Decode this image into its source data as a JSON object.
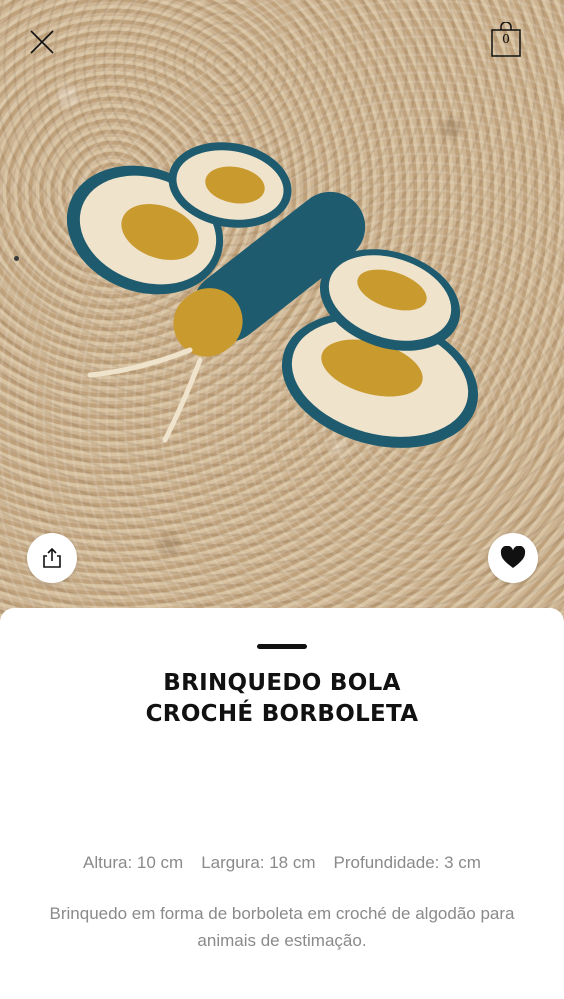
{
  "header": {
    "close_icon": "close-icon",
    "bag_icon": "shopping-bag-icon",
    "bag_count": "0"
  },
  "image": {
    "subject": "crochet-butterfly-toy",
    "colors": {
      "teal": "#1f5b6e",
      "mustard": "#c99a2e",
      "cream": "#efe3cc",
      "rug": "#c8ad88"
    }
  },
  "actions": {
    "share_icon": "share-icon",
    "favorite_icon": "heart-icon"
  },
  "product": {
    "title_line1": "BRINQUEDO BOLA",
    "title_line2": "CROCHÉ BORBOLETA",
    "dimensions": [
      "Altura: 10 cm",
      "Largura: 18 cm",
      "Profundidade: 3 cm"
    ],
    "description": "Brinquedo em forma de borboleta em croché de algodão para animais de estimação."
  }
}
